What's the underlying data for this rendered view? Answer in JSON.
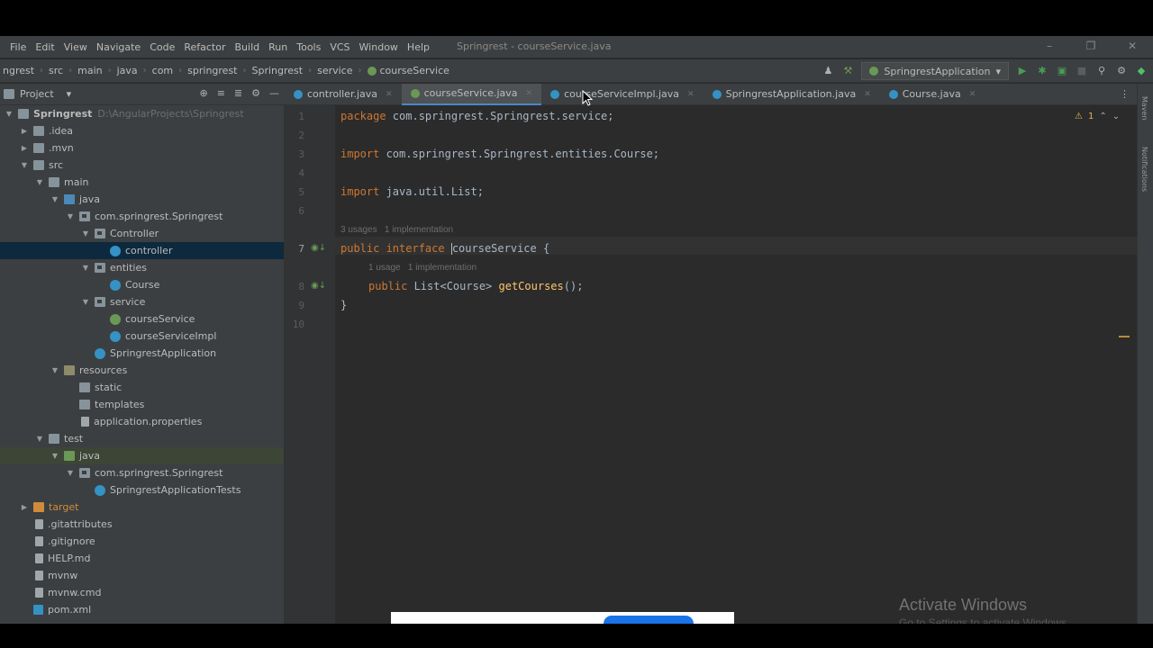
{
  "menubar": {
    "items": [
      "File",
      "Edit",
      "View",
      "Navigate",
      "Code",
      "Refactor",
      "Build",
      "Run",
      "Tools",
      "VCS",
      "Window",
      "Help"
    ],
    "window_title": "Springrest - courseService.java"
  },
  "breadcrumb": [
    "ngrest",
    "src",
    "main",
    "java",
    "com",
    "springrest",
    "Springrest",
    "service",
    "courseService"
  ],
  "run_config": "SpringrestApplication",
  "project_panel": {
    "title": "Project"
  },
  "tree": [
    {
      "label": "Springrest",
      "extra": "D:\\AngularProjects\\Springrest",
      "depth": 0,
      "icon": "folder",
      "arrow": "down"
    },
    {
      "label": ".idea",
      "depth": 1,
      "icon": "folder",
      "arrow": "right"
    },
    {
      "label": ".mvn",
      "depth": 1,
      "icon": "folder",
      "arrow": "right"
    },
    {
      "label": "src",
      "depth": 1,
      "icon": "folder",
      "arrow": "down"
    },
    {
      "label": "main",
      "depth": 2,
      "icon": "folder",
      "arrow": "down"
    },
    {
      "label": "java",
      "depth": 3,
      "icon": "src",
      "arrow": "down"
    },
    {
      "label": "com.springrest.Springrest",
      "depth": 4,
      "icon": "pkg",
      "arrow": "down"
    },
    {
      "label": "Controller",
      "depth": 5,
      "icon": "pkg",
      "arrow": "down"
    },
    {
      "label": "controller",
      "depth": 6,
      "icon": "class",
      "arrow": "",
      "selected": true
    },
    {
      "label": "entities",
      "depth": 5,
      "icon": "pkg",
      "arrow": "down"
    },
    {
      "label": "Course",
      "depth": 6,
      "icon": "class",
      "arrow": ""
    },
    {
      "label": "service",
      "depth": 5,
      "icon": "pkg",
      "arrow": "down"
    },
    {
      "label": "courseService",
      "depth": 6,
      "icon": "class",
      "arrow": ""
    },
    {
      "label": "courseServiceImpl",
      "depth": 6,
      "icon": "class",
      "arrow": ""
    },
    {
      "label": "SpringrestApplication",
      "depth": 5,
      "icon": "class",
      "arrow": ""
    },
    {
      "label": "resources",
      "depth": 3,
      "icon": "res",
      "arrow": "down"
    },
    {
      "label": "static",
      "depth": 4,
      "icon": "folder",
      "arrow": ""
    },
    {
      "label": "templates",
      "depth": 4,
      "icon": "folder",
      "arrow": ""
    },
    {
      "label": "application.properties",
      "depth": 4,
      "icon": "file",
      "arrow": ""
    },
    {
      "label": "test",
      "depth": 2,
      "icon": "folder",
      "arrow": "down"
    },
    {
      "label": "java",
      "depth": 3,
      "icon": "test",
      "arrow": "down",
      "green": true
    },
    {
      "label": "com.springrest.Springrest",
      "depth": 4,
      "icon": "pkg",
      "arrow": "down"
    },
    {
      "label": "SpringrestApplicationTests",
      "depth": 5,
      "icon": "class",
      "arrow": ""
    },
    {
      "label": "target",
      "depth": 1,
      "icon": "target",
      "arrow": "right"
    },
    {
      "label": ".gitattributes",
      "depth": 1,
      "icon": "file",
      "arrow": ""
    },
    {
      "label": ".gitignore",
      "depth": 1,
      "icon": "file",
      "arrow": ""
    },
    {
      "label": "HELP.md",
      "depth": 1,
      "icon": "file",
      "arrow": ""
    },
    {
      "label": "mvnw",
      "depth": 1,
      "icon": "file",
      "arrow": ""
    },
    {
      "label": "mvnw.cmd",
      "depth": 1,
      "icon": "file",
      "arrow": ""
    },
    {
      "label": "pom.xml",
      "depth": 1,
      "icon": "xml",
      "arrow": ""
    }
  ],
  "tabs": [
    {
      "label": "controller.java",
      "active": false
    },
    {
      "label": "courseService.java",
      "active": true
    },
    {
      "label": "courseServiceImpl.java",
      "active": false
    },
    {
      "label": "SpringrestApplication.java",
      "active": false
    },
    {
      "label": "Course.java",
      "active": false
    }
  ],
  "editor": {
    "line_numbers": [
      "1",
      "2",
      "3",
      "4",
      "5",
      "6",
      "7",
      "8",
      "9",
      "10"
    ],
    "line1": {
      "kw": "package ",
      "rest": "com.springrest.Springrest.service;"
    },
    "line3": {
      "kw": "import ",
      "rest": "com.springrest.Springrest.entities.Course;"
    },
    "line5": {
      "kw": "import ",
      "rest": "java.util.List;"
    },
    "hint1": "3 usages   1 implementation",
    "line7": {
      "kw": "public interface ",
      "name": "courseService",
      "rest": " {"
    },
    "hint2": "1 usage   1 implementation",
    "line8": {
      "kw": "public ",
      "type": "List<Course> ",
      "fn": "getCourses",
      "rest": "();"
    },
    "line9": "}",
    "warnings": "1"
  },
  "right_strip": {
    "top": "Maven",
    "bottom": "Notifications"
  },
  "watermark": {
    "title": "Activate Windows",
    "sub": "Go to Settings to activate Windows."
  }
}
